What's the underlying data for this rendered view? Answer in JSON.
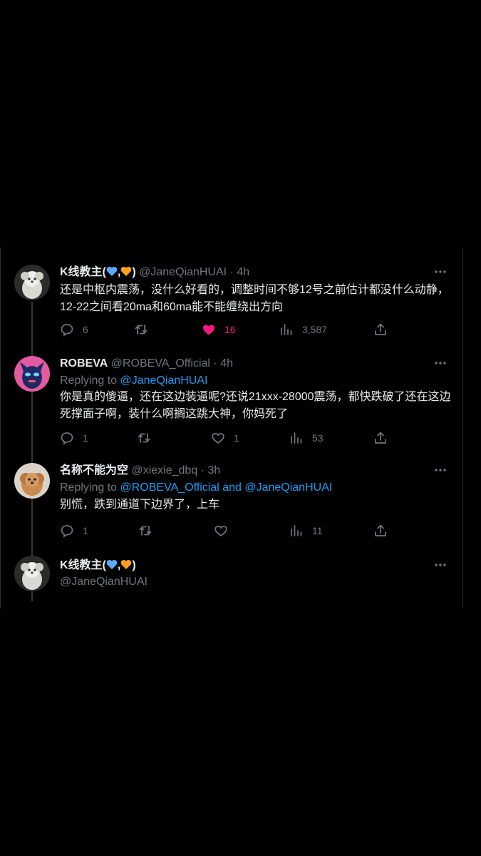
{
  "tweets": [
    {
      "name": "K线教主(",
      "name_sep": ",",
      "name_end": ")",
      "handle": "@JaneQianHUAI",
      "dot": "·",
      "time": "4h",
      "text": "还是中枢内震荡，没什么好看的，调整时间不够12号之前估计都没什么动静，12-22之间看20ma和60ma能不能缠绕出方向",
      "replies": "6",
      "likes": "16",
      "views": "3,587",
      "liked": true
    },
    {
      "name": "ROBEVA",
      "handle": "@ROBEVA_Official",
      "dot": "·",
      "time": "4h",
      "replying_prefix": "Replying to ",
      "replying_to": "@JaneQianHUAI",
      "text": "你是真的傻逼，还在这边装逼呢?还说21xxx-28000震荡，都快跌破了还在这边死撑面子啊，装什么啊搁这跳大神，你妈死了",
      "replies": "1",
      "likes": "1",
      "views": "53"
    },
    {
      "name": "名称不能为空",
      "handle": "@xiexie_dbq",
      "dot": "·",
      "time": "3h",
      "replying_prefix": "Replying to ",
      "replying_to_1": "@ROBEVA_Official",
      "replying_and": " and ",
      "replying_to_2": "@JaneQianHUAI",
      "text": "别慌，跌到通道下边界了，上车",
      "replies": "1",
      "views": "11"
    },
    {
      "name": "K线教主(",
      "name_sep": ",",
      "name_end": ")",
      "handle": "@JaneQianHUAI"
    }
  ],
  "icons": {
    "reply": "reply-icon",
    "retweet": "retweet-icon",
    "like": "heart-icon",
    "views": "views-icon",
    "share": "share-icon",
    "more": "more-icon"
  },
  "colors": {
    "background": "#000000",
    "text": "#e7e9ea",
    "secondary": "#71767b",
    "link": "#1d9bf0",
    "like": "#f91880",
    "blue_heart": "#5aa9ff",
    "orange_heart": "#ff9f1c"
  }
}
